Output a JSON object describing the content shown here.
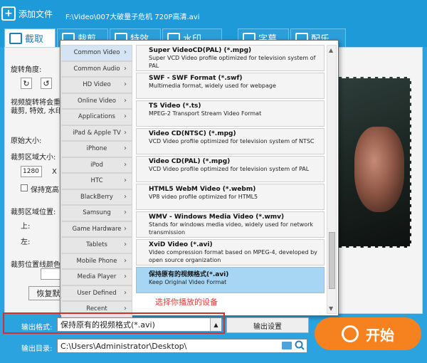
{
  "topbar": {
    "add_file_label": "添加文件",
    "file_path": "F:\\Video\\007大破量子危机 720P高清.avi"
  },
  "tabs": [
    {
      "label": "截取"
    },
    {
      "label": "裁剪"
    },
    {
      "label": "特效"
    },
    {
      "label": "水印"
    },
    {
      "label": "字幕"
    },
    {
      "label": "配乐"
    }
  ],
  "side_panel": {
    "rotate_label": "旋转角度:",
    "rotate_note_1": "视频旋转将会重",
    "rotate_note_2": "裁剪, 特效, 水印",
    "original_size_label": "原始大小:",
    "crop_size_label": "裁剪区域大小:",
    "width_value": "1280",
    "times_sign": "X",
    "keep_ratio_label": "保持宽高",
    "crop_position_label": "裁剪区域位置:",
    "top_label": "上:",
    "left_label": "左:",
    "crop_border_label": "裁剪位置线颜色",
    "restore_label": "恢复默"
  },
  "dropdown": {
    "categories": [
      {
        "label": "Common Video"
      },
      {
        "label": "Common Audio"
      },
      {
        "label": "HD Video"
      },
      {
        "label": "Online Video"
      },
      {
        "label": "Applications"
      },
      {
        "label": "iPad & Apple TV"
      },
      {
        "label": "iPhone"
      },
      {
        "label": "iPod"
      },
      {
        "label": "HTC"
      },
      {
        "label": "BlackBerry"
      },
      {
        "label": "Samsung"
      },
      {
        "label": "Game Hardware"
      },
      {
        "label": "Tablets"
      },
      {
        "label": "Mobile Phone"
      },
      {
        "label": "Media Player"
      },
      {
        "label": "User Defined"
      },
      {
        "label": "Recent"
      }
    ],
    "formats": [
      {
        "title": "Super VideoCD(PAL) (*.mpg)",
        "desc": "Super VCD Video profile optimized for television system of PAL"
      },
      {
        "title": "SWF - SWF Format (*.swf)",
        "desc": "Multimedia format, widely used for webpage"
      },
      {
        "title": "TS Video (*.ts)",
        "desc": "MPEG-2 Transport Stream Video Format"
      },
      {
        "title": "Video CD(NTSC) (*.mpg)",
        "desc": "VCD Video profile optimized for television system of NTSC"
      },
      {
        "title": "Video CD(PAL) (*.mpg)",
        "desc": "VCD Video profile optimized for television system of PAL"
      },
      {
        "title": "HTML5 WebM Video (*.webm)",
        "desc": "VP8 video profile optimized for HTML5"
      },
      {
        "title": "WMV - Windows Media Video (*.wmv)",
        "desc": "Stands for windows media video, widely used for network transmission"
      },
      {
        "title": "XviD Video (*.avi)",
        "desc": "Video compression format based on MPEG-4, developed by open source organization"
      },
      {
        "title": "保持原有的视频格式(*.avi)",
        "desc": "Keep Original Video Format"
      }
    ],
    "hint": "选择你播放的设备"
  },
  "bottom": {
    "output_format_label": "输出格式:",
    "output_format_value": "保持原有的视频格式(*.avi)",
    "output_settings_label": "输出设置",
    "output_dir_label": "输出目录:",
    "output_dir_value": "C:\\Users\\Administrator\\Desktop\\",
    "start_label": "开始"
  },
  "colors": {
    "accent_blue": "#1e9ad8",
    "start_orange": "#f5821f",
    "highlight_red": "#d32f2f",
    "hint_red": "#e53935",
    "selected_format": "#a6d6f4"
  }
}
